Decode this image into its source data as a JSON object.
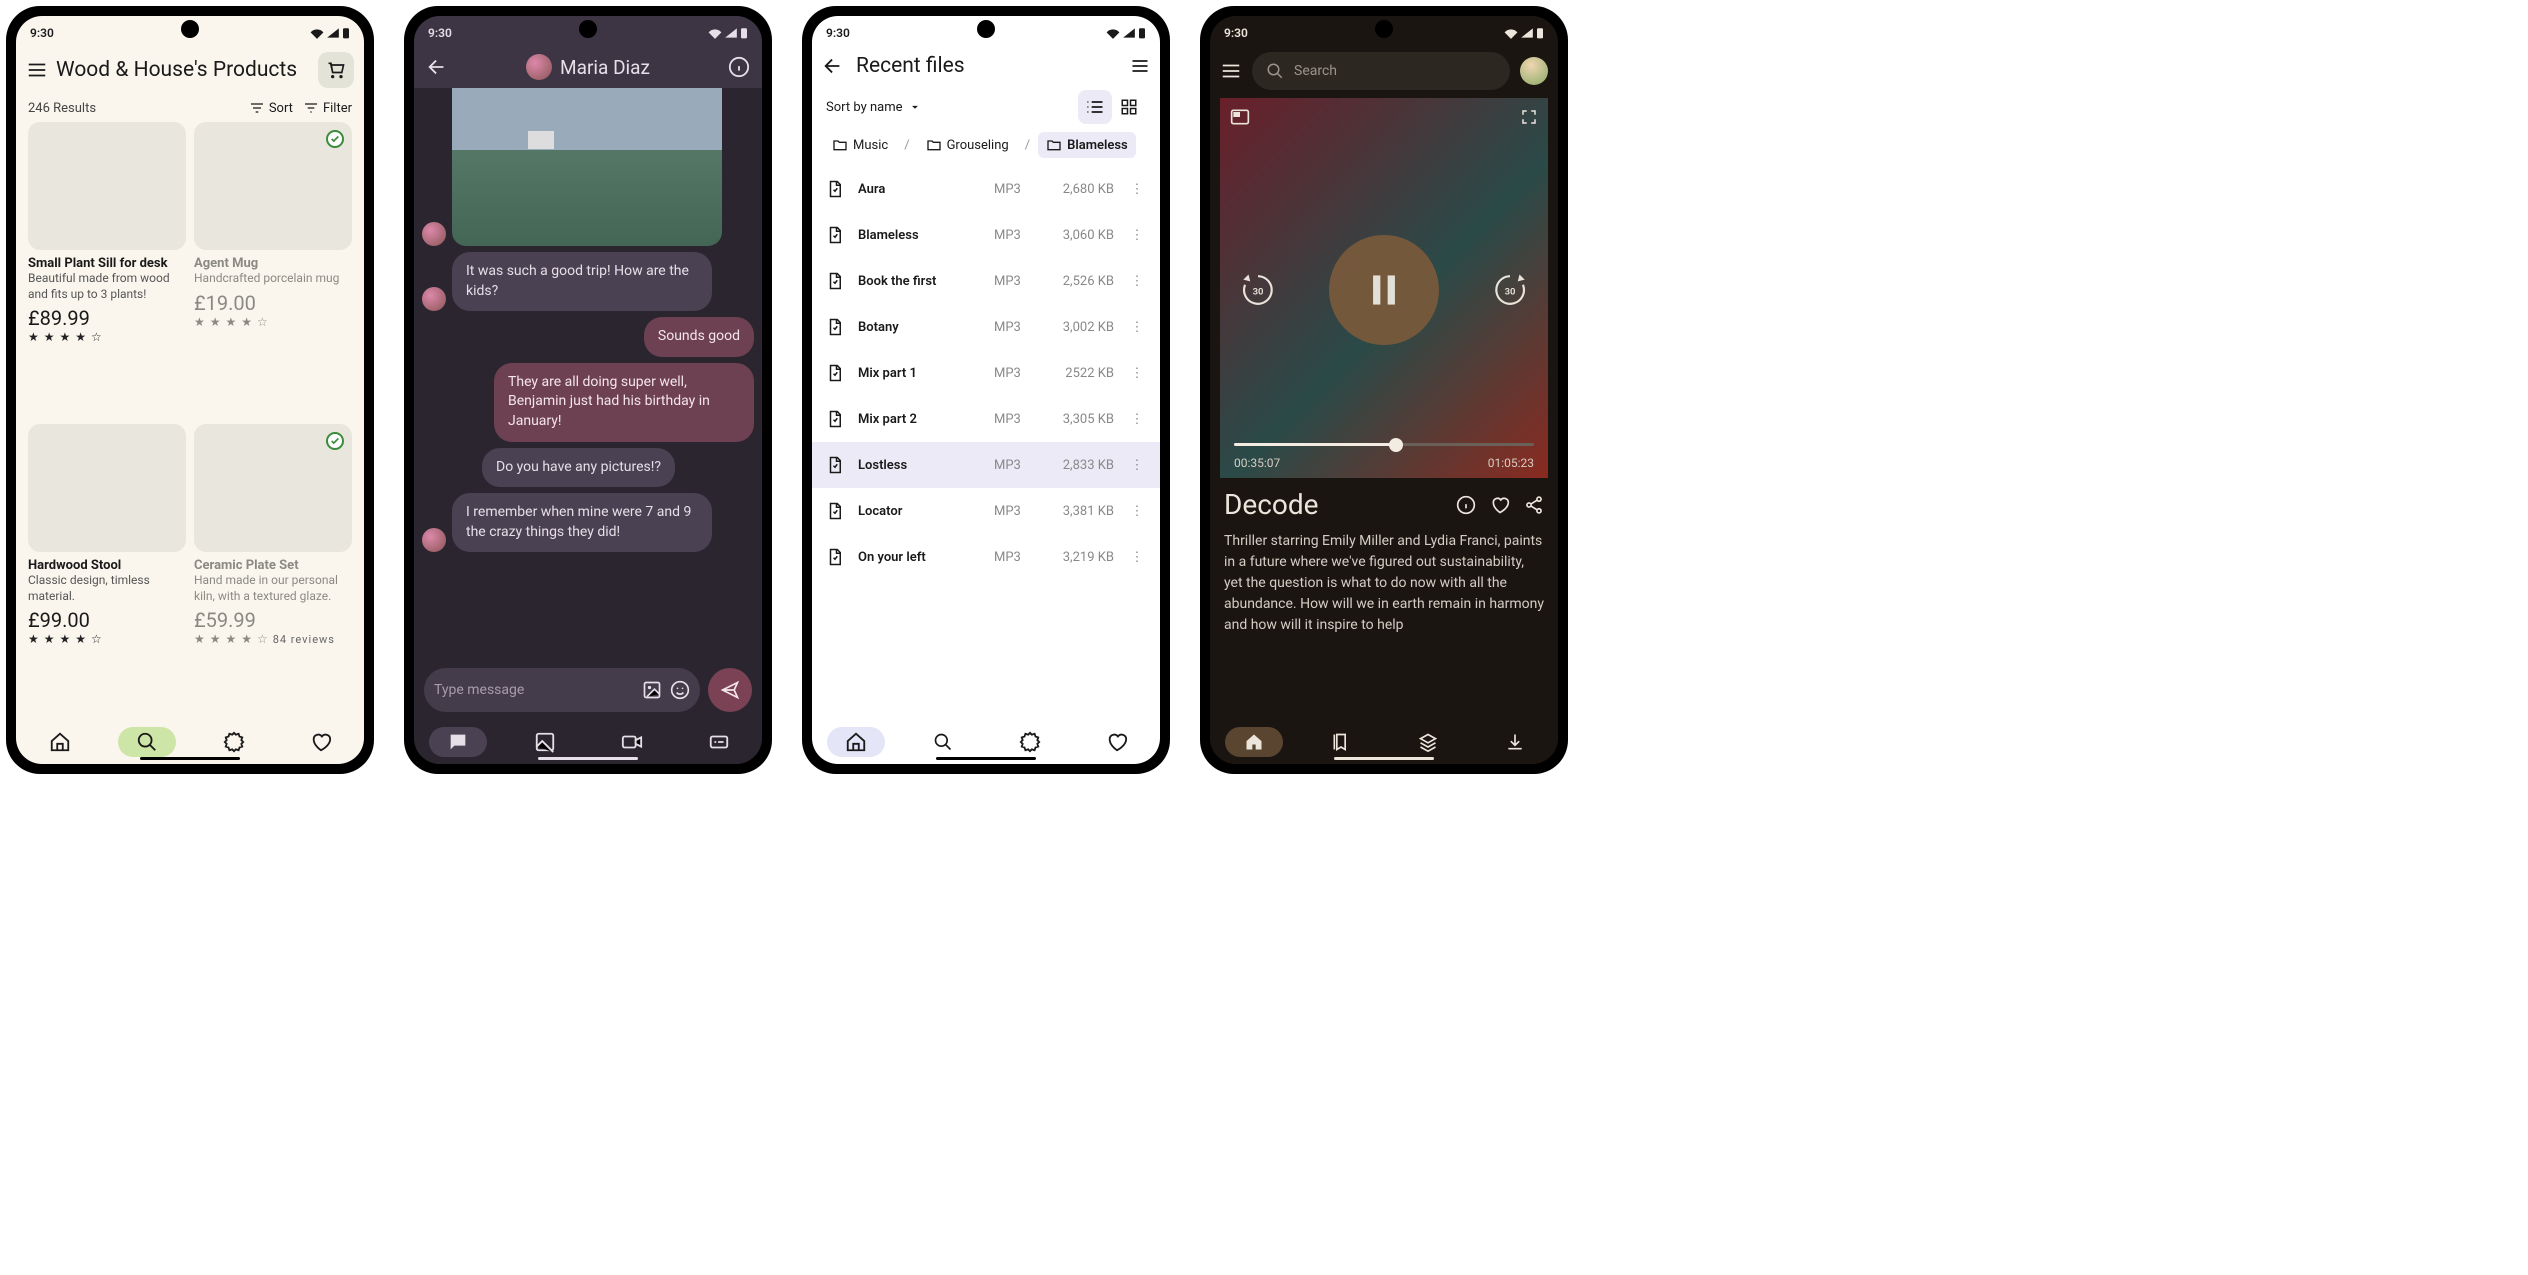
{
  "status_time": "9:30",
  "shop": {
    "title": "Wood & House's Products",
    "results": "246 Results",
    "sort": "Sort",
    "filter": "Filter",
    "products": [
      {
        "title": "Small Plant Sill for desk",
        "desc": "Beautiful made from wood and fits up to 3 plants!",
        "price": "£89.99",
        "check": false,
        "dim": false
      },
      {
        "title": "Agent Mug",
        "desc": "Handcrafted porcelain mug",
        "price": "£19.00",
        "check": true,
        "dim": true
      },
      {
        "title": "Hardwood Stool",
        "desc": "Classic design, timless material.",
        "price": "£99.00",
        "check": false,
        "dim": false
      },
      {
        "title": "Ceramic Plate Set",
        "desc": "Hand made in our personal kiln, with a textured glaze.",
        "price": "£59.99",
        "check": true,
        "dim": true,
        "reviews": "84 reviews"
      }
    ]
  },
  "chat": {
    "name": "Maria Diaz",
    "messages": [
      {
        "text": "It was such a good trip! How are the kids?",
        "me": false,
        "avatar": true
      },
      {
        "text": "Sounds good",
        "me": true
      },
      {
        "text": "They are all doing super well, Benjamin just had his birthday in January!",
        "me": true
      },
      {
        "text": "Do you have any pictures!?",
        "me": false,
        "avatar": false
      },
      {
        "text": "I remember when mine were 7 and 9 the crazy things they did!",
        "me": false,
        "avatar": true
      }
    ],
    "placeholder": "Type message"
  },
  "files": {
    "title": "Recent files",
    "sort": "Sort by name",
    "crumbs": [
      "Music",
      "Grouseling",
      "Blameless"
    ],
    "rows": [
      {
        "name": "Aura",
        "type": "MP3",
        "size": "2,680 KB"
      },
      {
        "name": "Blameless",
        "type": "MP3",
        "size": "3,060 KB"
      },
      {
        "name": "Book the first",
        "type": "MP3",
        "size": "2,526 KB"
      },
      {
        "name": "Botany",
        "type": "MP3",
        "size": "3,002 KB"
      },
      {
        "name": "Mix part 1",
        "type": "MP3",
        "size": "2522 KB"
      },
      {
        "name": "Mix part 2",
        "type": "MP3",
        "size": "3,305 KB"
      },
      {
        "name": "Lostless",
        "type": "MP3",
        "size": "2,833 KB",
        "sel": true
      },
      {
        "name": "Locator",
        "type": "MP3",
        "size": "3,381 KB"
      },
      {
        "name": "On your left",
        "type": "MP3",
        "size": "3,219 KB"
      }
    ]
  },
  "media": {
    "search_placeholder": "Search",
    "elapsed": "00:35:07",
    "total": "01:05:23",
    "title": "Decode",
    "skip_seconds": "30",
    "description": "Thriller starring Emily Miller and Lydia Franci, paints in a future where we've figured out sustainability, yet the question is what to do now with all the abundance. How will we in earth remain in harmony and how will it inspire to help"
  }
}
